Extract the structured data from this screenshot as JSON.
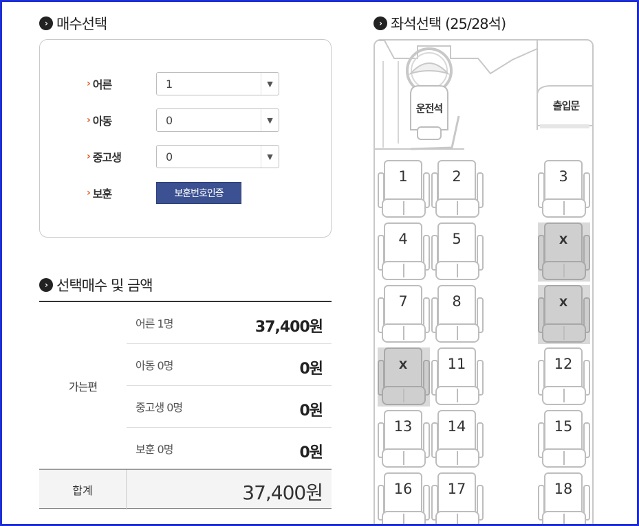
{
  "quantity_section": {
    "title": "매수선택",
    "rows": [
      {
        "label": "어른",
        "value": "1"
      },
      {
        "label": "아동",
        "value": "0"
      },
      {
        "label": "중고생",
        "value": "0"
      },
      {
        "label": "보훈",
        "button": "보훈번호인증"
      }
    ]
  },
  "fare_section": {
    "title": "선택매수 및 금액",
    "group_label": "가는편",
    "rows": [
      {
        "label": "어른 1명",
        "amount": "37,400원"
      },
      {
        "label": "아동 0명",
        "amount": "0원"
      },
      {
        "label": "중고생 0명",
        "amount": "0원"
      },
      {
        "label": "보훈 0명",
        "amount": "0원"
      }
    ],
    "total_label": "합계",
    "total_amount": "37,400원"
  },
  "seat_section": {
    "title": "좌석선택 (25/28석)",
    "driver_label": "운전석",
    "door_label": "출입문",
    "seats": [
      {
        "label": "1",
        "taken": false
      },
      {
        "label": "2",
        "taken": false
      },
      {
        "label": "3",
        "taken": false
      },
      {
        "label": "4",
        "taken": false
      },
      {
        "label": "5",
        "taken": false
      },
      {
        "label": "X",
        "taken": true
      },
      {
        "label": "7",
        "taken": false
      },
      {
        "label": "8",
        "taken": false
      },
      {
        "label": "X",
        "taken": true
      },
      {
        "label": "X",
        "taken": true
      },
      {
        "label": "11",
        "taken": false
      },
      {
        "label": "12",
        "taken": false
      },
      {
        "label": "13",
        "taken": false
      },
      {
        "label": "14",
        "taken": false
      },
      {
        "label": "15",
        "taken": false
      },
      {
        "label": "16",
        "taken": false
      },
      {
        "label": "17",
        "taken": false
      },
      {
        "label": "18",
        "taken": false
      }
    ]
  },
  "colors": {
    "frame": "#1f2fd6",
    "auth_button": "#3c5191",
    "label_arrow": "#d9581e",
    "seat_taken": "#d9d9d9"
  }
}
